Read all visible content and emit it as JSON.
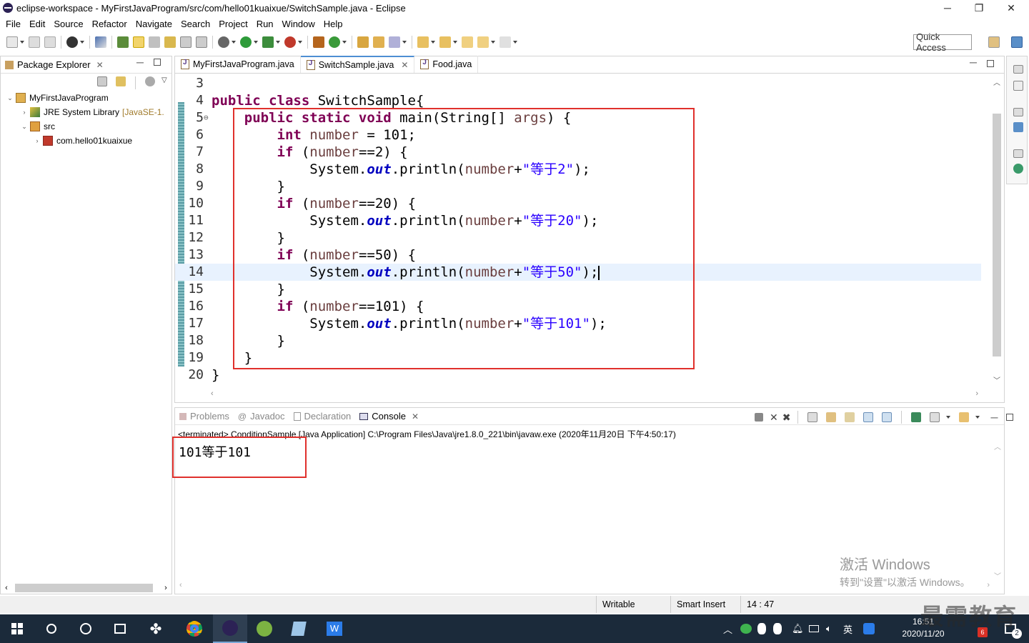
{
  "window": {
    "title": "eclipse-workspace - MyFirstJavaProgram/src/com/hello01kuaixue/SwitchSample.java - Eclipse",
    "minimize": "─",
    "maximize": "❐",
    "close": "✕"
  },
  "menu": [
    "File",
    "Edit",
    "Source",
    "Refactor",
    "Navigate",
    "Search",
    "Project",
    "Run",
    "Window",
    "Help"
  ],
  "toolbar": {
    "quick_access": "Quick Access"
  },
  "package_explorer": {
    "tab_label": "Package Explorer",
    "tree": [
      {
        "label": "MyFirstJavaProgram",
        "extra": "",
        "icon": "project-icon",
        "twisty": "⌄"
      },
      {
        "label": "JRE System Library",
        "extra": "[JavaSE-1.",
        "icon": "library-icon",
        "twisty": "›"
      },
      {
        "label": "src",
        "extra": "",
        "icon": "source-folder-icon",
        "twisty": "⌄"
      },
      {
        "label": "com.hello01kuaixue",
        "extra": "",
        "icon": "package-icon",
        "twisty": "›"
      }
    ]
  },
  "editor": {
    "tabs": [
      {
        "label": "MyFirstJavaProgram.java",
        "active": false
      },
      {
        "label": "SwitchSample.java",
        "active": true
      },
      {
        "label": "Food.java",
        "active": false
      }
    ],
    "line_numbers": [
      "3",
      "4",
      "5",
      "6",
      "7",
      "8",
      "9",
      "10",
      "11",
      "12",
      "13",
      "14",
      "15",
      "16",
      "17",
      "18",
      "19",
      "20"
    ],
    "code": {
      "l4_kw": "public class ",
      "l4_rest": "SwitchSample{",
      "l5_kw": "public static void ",
      "l5_rest": "main(String[] ",
      "l5_var": "args",
      "l5_end": ") {",
      "l6_kw": "int ",
      "l6_var": "number",
      "l6_rest": " = 101;",
      "l7_kw": "if ",
      "l7_a": "(",
      "l7_var": "number",
      "l7_b": "==2) {",
      "sys": "System.",
      "out": "out",
      "println": ".println(",
      "num": "number",
      "plus": "+",
      "l8_str": "\"等于2\"",
      "l11_str": "\"等于20\"",
      "l14_str": "\"等于50\"",
      "l17_str": "\"等于101\"",
      "close_paren": ");",
      "brace": "}",
      "l10_b": "==20) {",
      "l13_b": "==50) {",
      "l16_b": "==101) {"
    },
    "current_line": "14"
  },
  "console": {
    "tabs": [
      {
        "label": "Problems",
        "active": false
      },
      {
        "label": "Javadoc",
        "active": false
      },
      {
        "label": "Declaration",
        "active": false
      },
      {
        "label": "Console",
        "active": true
      }
    ],
    "status": "<terminated> ConditionSample [Java Application] C:\\Program Files\\Java\\jre1.8.0_221\\bin\\javaw.exe (2020年11月20日 下午4:50:17)",
    "output": "101等于101"
  },
  "statusbar": {
    "writable": "Writable",
    "insert_mode": "Smart Insert",
    "position": "14 : 47"
  },
  "watermark": {
    "line1": "激活 Windows",
    "line2": "转到\"设置\"以激活 Windows。",
    "brand": "最需教育"
  },
  "taskbar": {
    "time": "16:51",
    "date": "2020/11/20",
    "ime": "英",
    "badge": "6",
    "notif_count": "2"
  },
  "colors": {
    "keyword": "#7f0055",
    "string": "#2a00ff",
    "field": "#0000c0",
    "highlight_box": "#e0302c",
    "taskbar": "#1b2a3a"
  }
}
